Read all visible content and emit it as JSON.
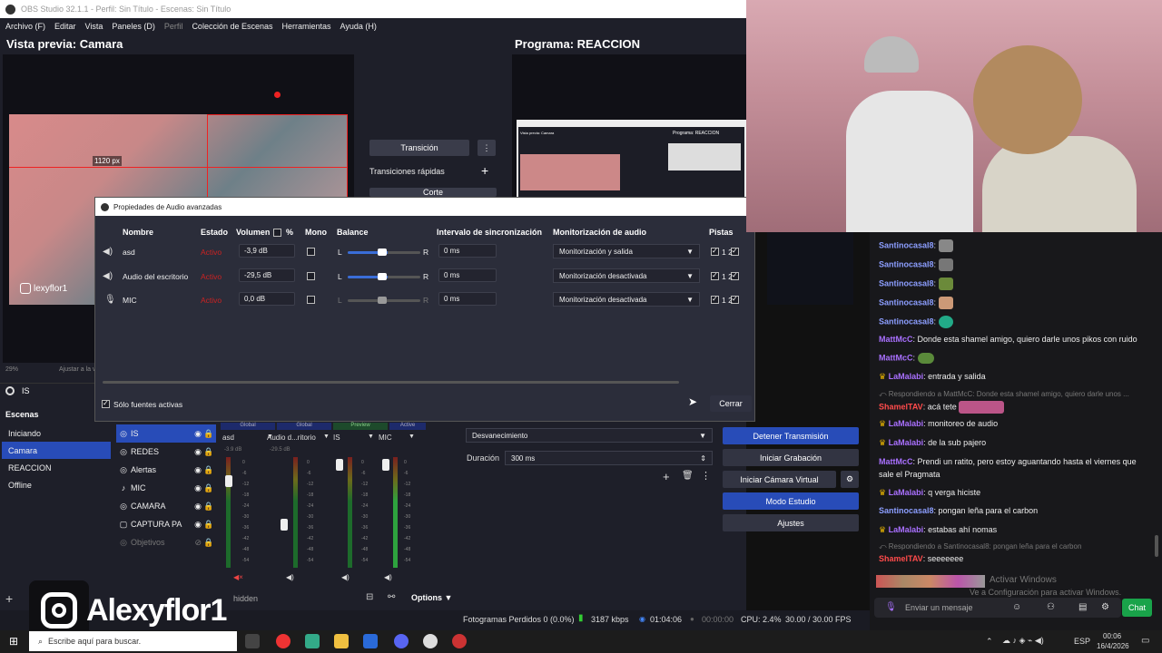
{
  "window": {
    "title": "OBS Studio 32.1.1 - Perfil: Sin Título - Escenas: Sin Título"
  },
  "menu": [
    "Archivo (F)",
    "Editar",
    "Vista",
    "Paneles (D)",
    "Perfil",
    "Colección de Escenas",
    "Herramientas",
    "Ayuda (H)"
  ],
  "preview": {
    "label": "Vista previa: Camara",
    "size_badge": "1120 px",
    "zoom": "29%",
    "zoom_hint": "Ajustar a la v"
  },
  "program": {
    "label": "Programa: REACCION",
    "thumb_label": "Programa: REACCION",
    "thumb_prev": "Vista previa: Camara"
  },
  "transitions": {
    "transition_label": "Transición",
    "quick_label": "Transiciones rápidas",
    "cut_label": "Corte"
  },
  "audio_dialog": {
    "title": "Propiedades de Audio avanzadas",
    "headers": [
      "Nombre",
      "Estado",
      "Volumen",
      "%",
      "Mono",
      "Balance",
      "Intervalo de sincronización",
      "Monitorización de audio",
      "Pistas"
    ],
    "rows": [
      {
        "name": "asd",
        "state": "Activo",
        "volume": "-3,9 dB",
        "sync": "0 ms",
        "monitor": "Monitorización y salida",
        "tracks": "1  2"
      },
      {
        "name": "Audio del escritorio",
        "state": "Activo",
        "volume": "-29,5 dB",
        "sync": "0 ms",
        "monitor": "Monitorización desactivada",
        "tracks": "1  2"
      },
      {
        "name": "MIC",
        "state": "Activo",
        "volume": "0,0 dB",
        "sync": "0 ms",
        "monitor": "Monitorización desactivada",
        "tracks": "1  2"
      }
    ],
    "balance_l": "L",
    "balance_r": "R",
    "active_only": "Sólo fuentes activas",
    "close": "Cerrar"
  },
  "current_source": "IS",
  "scenes": {
    "header": "Escenas",
    "items": [
      "Iniciando",
      "Camara",
      "REACCION",
      "Offline"
    ],
    "selected": 1
  },
  "sources": {
    "items": [
      "IS",
      "REDES",
      "Alertas",
      "MIC",
      "CAMARA",
      "CAPTURA PA",
      "Objetivos"
    ],
    "selected": 0
  },
  "mixer": {
    "tags": [
      "Global",
      "Global",
      "Preview",
      "Active"
    ],
    "channels": [
      {
        "name": "asd",
        "db": "-3.9 dB"
      },
      {
        "name": "Audio d...ritorio",
        "db": "-29.5 dB"
      },
      {
        "name": "IS",
        "db": ""
      },
      {
        "name": "MIC",
        "db": ""
      }
    ],
    "scale": [
      "0",
      "-6",
      "-12",
      "-18",
      "-24",
      "-30",
      "-36",
      "-42",
      "-48",
      "-54",
      "-60"
    ],
    "hidden": "hidden",
    "options": "Options"
  },
  "transition_dock": {
    "selected": "Desvanecimiento",
    "duration_label": "Duración",
    "duration": "300 ms"
  },
  "controls": {
    "stop_stream": "Detener Transmisión",
    "start_record": "Iniciar Grabación",
    "virtual_cam": "Iniciar Cámara Virtual",
    "studio": "Modo Estudio",
    "settings": "Ajustes"
  },
  "status": {
    "dropped": "Fotogramas Perdidos 0 (0.0%)",
    "kbps": "3187 kbps",
    "stream_time": "01:04:06",
    "record_time": "00:00:00",
    "cpu": "CPU: 2.4%",
    "fps": "30.00 / 30.00 FPS"
  },
  "overlay": {
    "handle": "lexyflor1",
    "big_handle": "Alexyflor1"
  },
  "chat": {
    "messages": [
      {
        "user": "Santinocasal8",
        "text": ":",
        "color": "#8c9eff",
        "reply": ""
      },
      {
        "user": "Santinocasal8",
        "text": ":",
        "color": "#8c9eff",
        "reply": ""
      },
      {
        "user": "Santinocasal8",
        "text": ":",
        "color": "#8c9eff",
        "reply": ""
      },
      {
        "user": "Santinocasal8",
        "text": ":",
        "color": "#8c9eff",
        "reply": ""
      },
      {
        "user": "Santinocasal8",
        "text": ":",
        "color": "#8c9eff",
        "reply": ""
      },
      {
        "user": "MattMcC",
        "text": ": Donde esta shamel amigo, quiero darle unos pikos con ruido",
        "color": "#a970ff",
        "reply": ""
      },
      {
        "user": "MattMcC",
        "text": ":",
        "color": "#a970ff",
        "reply": ""
      },
      {
        "user": "LaMalabi",
        "text": ": entrada y salida",
        "color": "#a970ff",
        "reply": ""
      },
      {
        "user": "ShamelTAV",
        "text": ": acá tete",
        "color": "#ff4b4b",
        "reply": "Respondiendo a MattMcC: Donde esta shamel amigo, quiero darle unos ..."
      },
      {
        "user": "LaMalabi",
        "text": ": monitoreo de audio",
        "color": "#a970ff",
        "reply": ""
      },
      {
        "user": "LaMalabi",
        "text": ": de la sub pajero",
        "color": "#a970ff",
        "reply": ""
      },
      {
        "user": "MattMcC",
        "text": ": Prendi un ratito, pero estoy aguantando hasta el viernes que",
        "color": "#a970ff",
        "reply": ""
      },
      {
        "user": "",
        "text": "sale el Pragmata",
        "color": "#a970ff",
        "reply": ""
      },
      {
        "user": "LaMalabi",
        "text": ": q verga hiciste",
        "color": "#a970ff",
        "reply": ""
      },
      {
        "user": "Santinocasal8",
        "text": ": pongan leña para el carbon",
        "color": "#8c9eff",
        "reply": ""
      },
      {
        "user": "LaMalabi",
        "text": ": estabas ahí nomas",
        "color": "#a970ff",
        "reply": ""
      },
      {
        "user": "ShamelTAV",
        "text": ": seeeeeee",
        "color": "#ff4b4b",
        "reply": "Respondiendo a Santinocasal8: pongan leña para el carbon"
      }
    ],
    "activate": "Ve a Configuración para activar Windows.",
    "activate_title": "Activar Windows",
    "placeholder": "Enviar un mensaje",
    "chat_button": "Chat"
  },
  "taskbar": {
    "search": "Escribe aquí para buscar.",
    "lang": "ESP",
    "time": "00:06",
    "date": "16/4/2026"
  }
}
